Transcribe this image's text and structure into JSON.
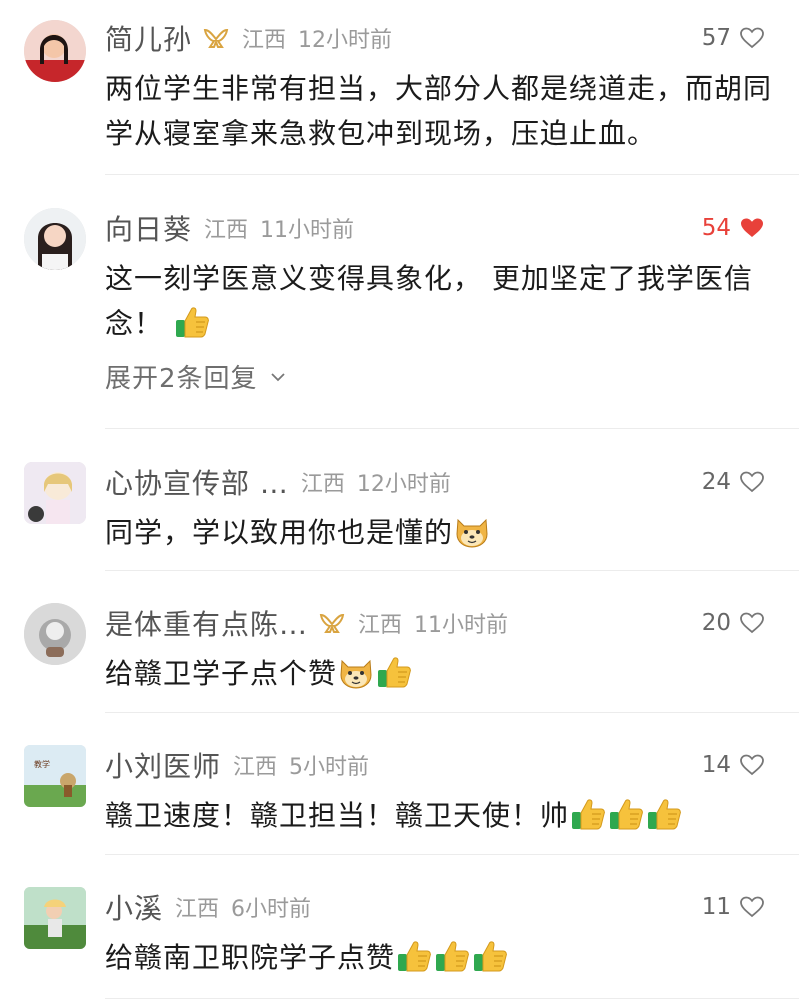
{
  "comments": [
    {
      "name": "简儿孙",
      "location": "江西",
      "time": "12小时前",
      "likes": "57",
      "liked": false,
      "badge": "ribbon-badge",
      "text": "两位学生非常有担当，大部分人都是绕道走，而胡同学从寝室拿来急救包冲到现场，压迫止血。"
    },
    {
      "name": "向日葵",
      "location": "江西",
      "time": "11小时前",
      "likes": "54",
      "liked": true,
      "text_line1": "这一刻学医意义变得具象化， 更加坚定了我学医信",
      "text_line2": "念！",
      "emoji": "thumbs-up",
      "expand_label": "展开2条回复"
    },
    {
      "name": "心协宣传部 …",
      "location": "江西",
      "time": "12小时前",
      "likes": "24",
      "liked": false,
      "text": "同学，学以致用你也是懂的",
      "emoji": "doge"
    },
    {
      "name": "是体重有点陈…",
      "location": "江西",
      "time": "11小时前",
      "likes": "20",
      "liked": false,
      "badge": "ribbon-badge",
      "text": "给赣卫学子点个赞",
      "emoji": [
        "doge",
        "thumbs-up"
      ]
    },
    {
      "name": "小刘医师",
      "location": "江西",
      "time": "5小时前",
      "likes": "14",
      "liked": false,
      "text": "赣卫速度！赣卫担当！赣卫天使！帅",
      "emoji": [
        "thumbs-up",
        "thumbs-up",
        "thumbs-up"
      ]
    },
    {
      "name": "小溪",
      "location": "江西",
      "time": "6小时前",
      "likes": "11",
      "liked": false,
      "text": "给赣南卫职院学子点赞",
      "emoji": [
        "thumbs-up",
        "thumbs-up",
        "thumbs-up"
      ]
    }
  ],
  "colors": {
    "heart_liked": "#e8413a",
    "badge_gold": "#d9a441",
    "meta_gray": "#9a9a9a"
  }
}
